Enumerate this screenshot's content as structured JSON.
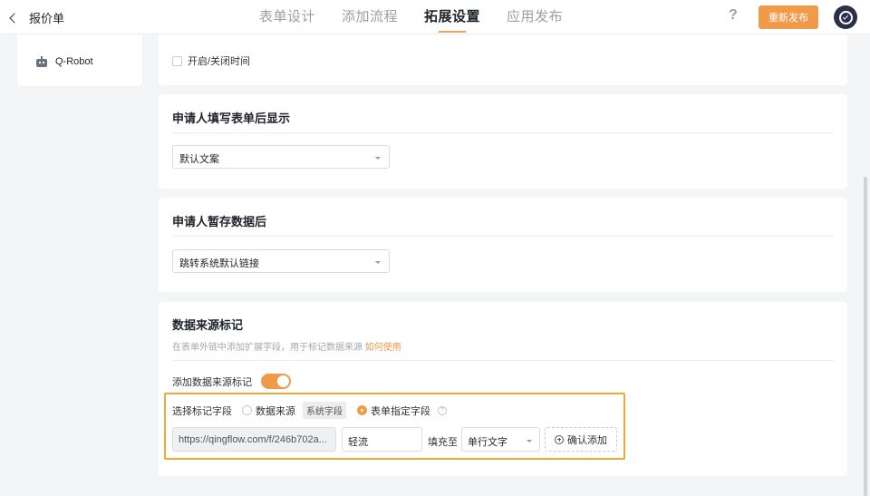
{
  "header": {
    "back_title": "报价单",
    "tabs": [
      {
        "label": "表单设计"
      },
      {
        "label": "添加流程"
      },
      {
        "label": "拓展设置"
      },
      {
        "label": "应用发布"
      }
    ],
    "active_tab": "拓展设置",
    "help_glyph": "?",
    "publish_label": "重新发布"
  },
  "sidebar": {
    "item_label": "Q-Robot"
  },
  "section_time": {
    "checkbox_label": "开启/关闭时间"
  },
  "section_after_submit": {
    "title": "申请人填写表单后显示",
    "select_value": "默认文案"
  },
  "section_after_save": {
    "title": "申请人暂存数据后",
    "select_value": "跳转系统默认链接"
  },
  "section_source": {
    "title": "数据来源标记",
    "description": "在表单外链中添加扩展字段，用于标记数据来源",
    "description_link": "如何使用",
    "toggle_label": "添加数据来源标记",
    "toggle_on": true,
    "field_label": "选择标记字段",
    "option_source": "数据来源",
    "option_source_tag": "系统字段",
    "option_form": "表单指定字段",
    "selected_option": "表单指定字段",
    "info_glyph": "?",
    "url_value": "https://qingflow.com/f/246b702a...",
    "text_value": "轻流",
    "fill_label": "填充至",
    "type_value": "单行文字",
    "add_label": "确认添加"
  },
  "colors": {
    "accent": "#f09a4a",
    "highlight_border": "#f3a831",
    "avatar_bg": "#2b2f4a"
  }
}
